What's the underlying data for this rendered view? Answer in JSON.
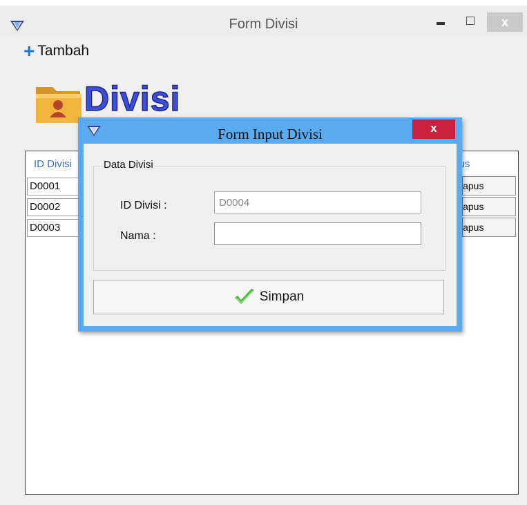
{
  "window": {
    "title": "Form Divisi",
    "close_glyph": "x"
  },
  "toolbar": {
    "add_icon": "plus-icon",
    "add_label": "Tambah"
  },
  "header": {
    "title": "Divisi",
    "icon": "folder-user-icon",
    "title_color": "#3b4fd8"
  },
  "table": {
    "columns": [
      "ID Divisi",
      "Hapus"
    ],
    "rows": [
      {
        "id": "D0001",
        "action": "Hapus"
      },
      {
        "id": "D0002",
        "action": "Hapus"
      },
      {
        "id": "D0003",
        "action": "Hapus"
      }
    ]
  },
  "dialog": {
    "title": "Form Input Divisi",
    "close_glyph": "x",
    "group_title": "Data Divisi",
    "fields": {
      "id_label": "ID Divisi :",
      "id_value": "D0004",
      "name_label": "Nama :",
      "name_value": ""
    },
    "save_label": "Simpan",
    "save_icon": "checkmark-icon",
    "accent": "#5aaaf0",
    "close_color": "#c8203d"
  }
}
